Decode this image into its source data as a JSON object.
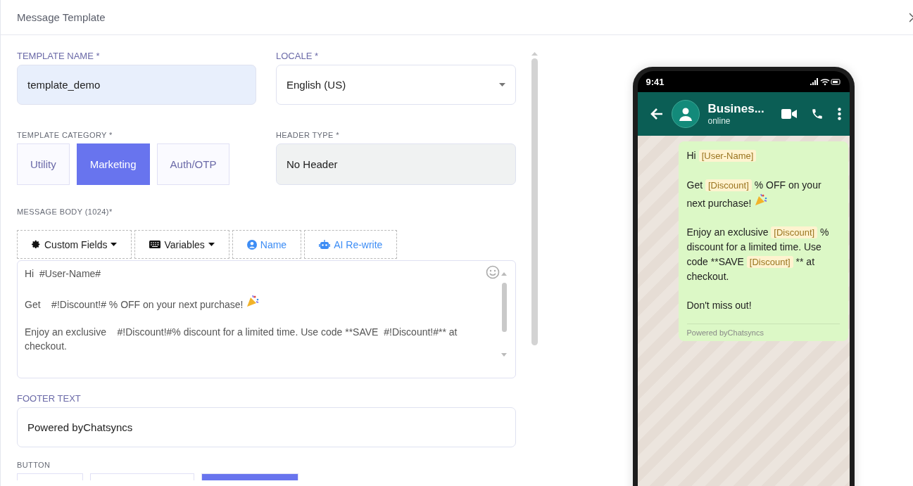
{
  "window": {
    "title": "Message Template"
  },
  "template_name": {
    "label": "TEMPLATE NAME *",
    "value": "template_demo"
  },
  "locale": {
    "label": "LOCALE *",
    "value": "English (US)"
  },
  "template_category": {
    "label": "TEMPLATE CATEGORY *",
    "options": [
      {
        "label": "Utility",
        "selected": false
      },
      {
        "label": "Marketing",
        "selected": true
      },
      {
        "label": "Auth/OTP",
        "selected": false
      }
    ]
  },
  "header_type": {
    "label": "HEADER TYPE *",
    "value": "No Header"
  },
  "message_body": {
    "label": "MESSAGE BODY (1024)*",
    "toolbar": [
      {
        "kind": "dropdown",
        "label": "Custom Fields"
      },
      {
        "kind": "dropdown",
        "label": "Variables"
      },
      {
        "kind": "link",
        "label": "Name"
      },
      {
        "kind": "link",
        "label": "AI Re-write"
      }
    ],
    "paragraphs": [
      {
        "text": "Hi  #User-Name#",
        "popper": false
      },
      {
        "text": "Get    #!Discount!# % OFF on your next purchase!",
        "popper": true
      },
      {
        "text": "Enjoy an exclusive    #!Discount!#% discount for a limited time. Use code **SAVE  #!Discount!#** at checkout.",
        "popper": false
      }
    ]
  },
  "footer_text": {
    "label": "FOOTER TEXT",
    "value": "Powered byChatsyncs"
  },
  "button_section": {
    "label": "BUTTON",
    "options": [
      {
        "selected": false
      },
      {
        "selected": false
      },
      {
        "selected": true
      }
    ]
  },
  "preview": {
    "time": "9:41",
    "contact": "Busines...",
    "status": "online",
    "paragraphs": [
      {
        "popper": false,
        "segments": [
          {
            "kind": "text",
            "text": "Hi "
          },
          {
            "kind": "variable",
            "text": "[User-Name]"
          }
        ]
      },
      {
        "popper": true,
        "segments": [
          {
            "kind": "text",
            "text": "Get  "
          },
          {
            "kind": "variable",
            "text": "[Discount]"
          },
          {
            "kind": "text",
            "text": " % OFF on your next purchase!"
          }
        ]
      },
      {
        "popper": false,
        "segments": [
          {
            "kind": "text",
            "text": "Enjoy an exclusive "
          },
          {
            "kind": "variable",
            "text": "[Discount]"
          },
          {
            "kind": "text",
            "text": " % discount for a limited time. Use code **SAVE "
          },
          {
            "kind": "variable",
            "text": "[Discount]"
          },
          {
            "kind": "text",
            "text": " ** at checkout."
          }
        ]
      },
      {
        "popper": false,
        "segments": [
          {
            "kind": "text",
            "text": "Don't miss out!"
          }
        ]
      }
    ],
    "footer": "Powered byChatsyncs"
  }
}
